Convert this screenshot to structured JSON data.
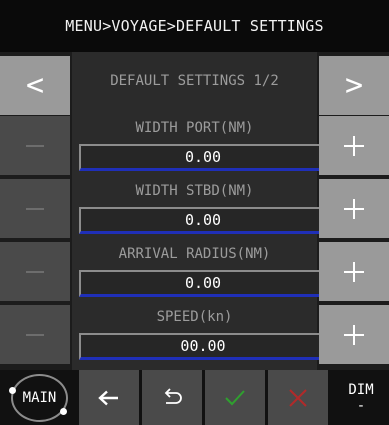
{
  "header": {
    "breadcrumb": "MENU>VOYAGE>DEFAULT SETTINGS"
  },
  "nav": {
    "prev_glyph": "<",
    "next_glyph": ">",
    "page_label": "DEFAULT SETTINGS 1/2"
  },
  "fields": [
    {
      "label": "WIDTH PORT(NM)",
      "value": "0.00"
    },
    {
      "label": "WIDTH STBD(NM)",
      "value": "0.00"
    },
    {
      "label": "ARRIVAL RADIUS(NM)",
      "value": "0.00"
    },
    {
      "label": "SPEED(kn)",
      "value": "00.00"
    }
  ],
  "footer": {
    "main_label": "MAIN",
    "dim_label": "DIM",
    "dim_sub": "-",
    "icons": [
      "left-arrow-icon",
      "undo-icon",
      "check-icon",
      "close-icon"
    ]
  },
  "colors": {
    "accent_blue": "#1f2fb8",
    "confirm_green": "#2fa02f",
    "cancel_red": "#b02a2a",
    "button_gray": "#9a9a9a",
    "button_dark": "#4a4a4a"
  }
}
